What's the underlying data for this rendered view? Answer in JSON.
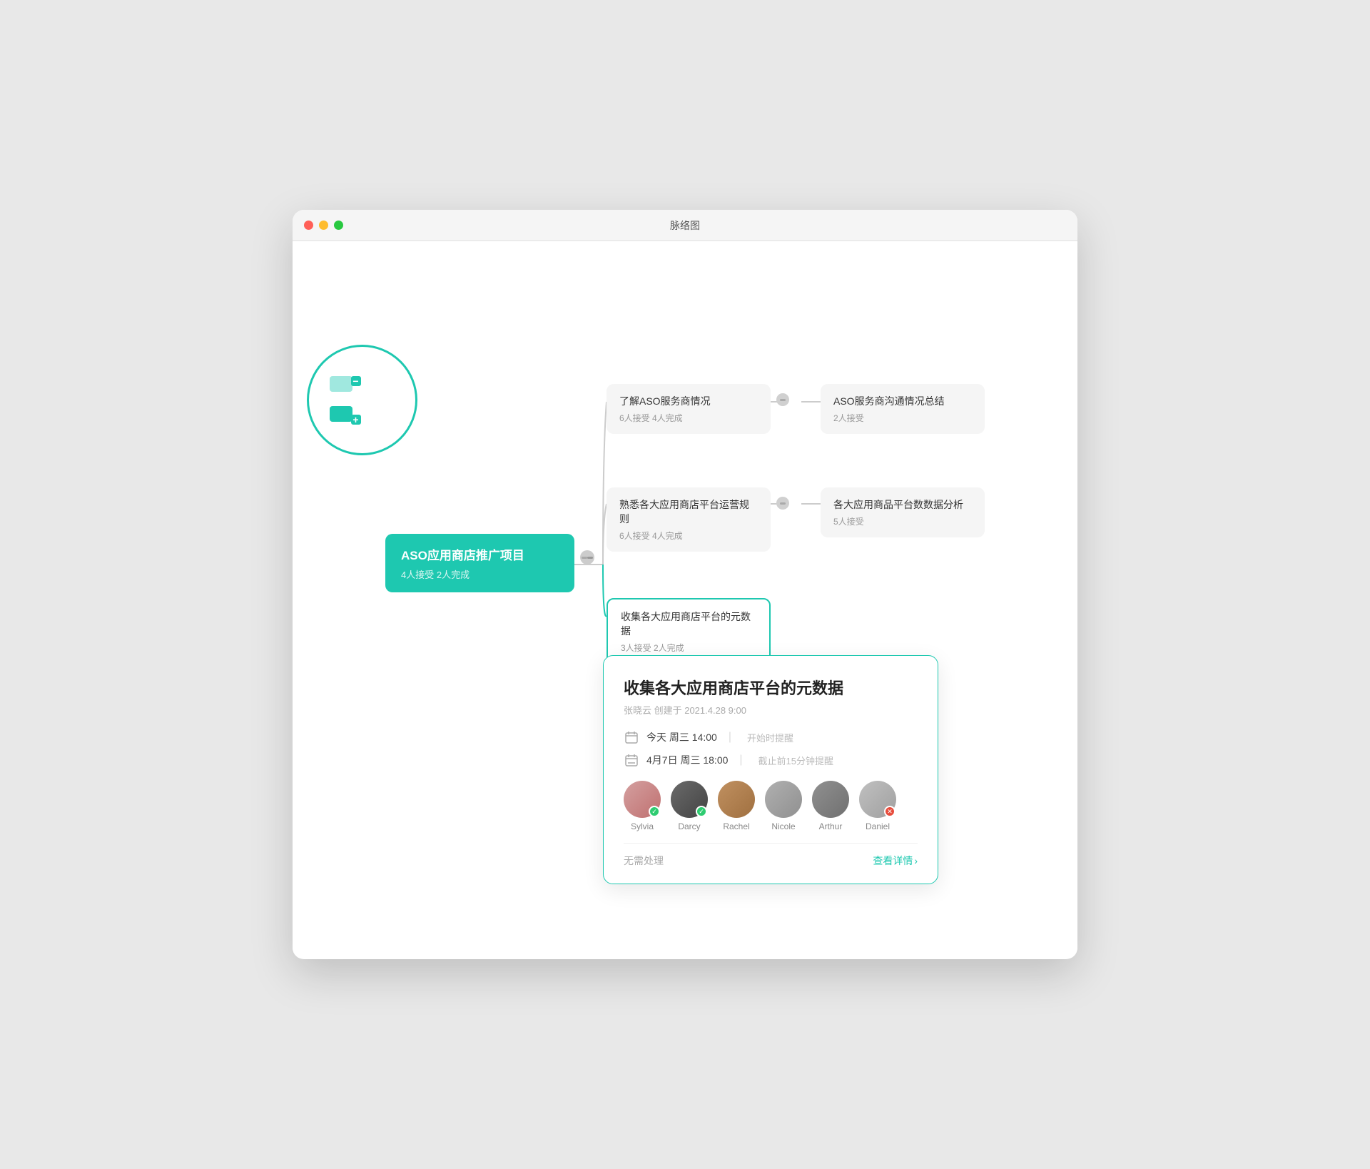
{
  "window": {
    "title": "脉络图"
  },
  "main_node": {
    "title": "ASO应用商店推广项目",
    "stats": "4人接受 2人完成"
  },
  "sub_nodes": [
    {
      "id": "node1",
      "title": "了解ASO服务商情况",
      "stats": "6人接受 4人完成"
    },
    {
      "id": "node2",
      "title": "ASO服务商沟通情况总结",
      "stats": "2人接受"
    },
    {
      "id": "node3",
      "title": "熟悉各大应用商店平台运营规则",
      "stats": "6人接受 4人完成"
    },
    {
      "id": "node4",
      "title": "各大应用商品平台数数据分析",
      "stats": "5人接受"
    },
    {
      "id": "node5",
      "title": "收集各大应用商店平台的元数据",
      "stats": "3人接受 2人完成"
    }
  ],
  "detail_card": {
    "title": "收集各大应用商店平台的元数据",
    "creator": "张晓云 创建于 2021.4.28  9:00",
    "start_time": "今天 周三 14:00",
    "start_reminder": "开始时提醒",
    "end_time": "4月7日 周三 18:00",
    "end_reminder": "截止前15分钟提醒",
    "no_action": "无需处理",
    "view_detail": "查看详情",
    "separator": "|",
    "avatars": [
      {
        "name": "Sylvia",
        "badge": "check",
        "color": "sylvia"
      },
      {
        "name": "Darcy",
        "badge": "check",
        "color": "darcy"
      },
      {
        "name": "Rachel",
        "badge": "none",
        "color": "rachel"
      },
      {
        "name": "Nicole",
        "badge": "none",
        "color": "nicole"
      },
      {
        "name": "Arthur",
        "badge": "none",
        "color": "arthur"
      },
      {
        "name": "Daniel",
        "badge": "x",
        "color": "daniel"
      }
    ]
  }
}
